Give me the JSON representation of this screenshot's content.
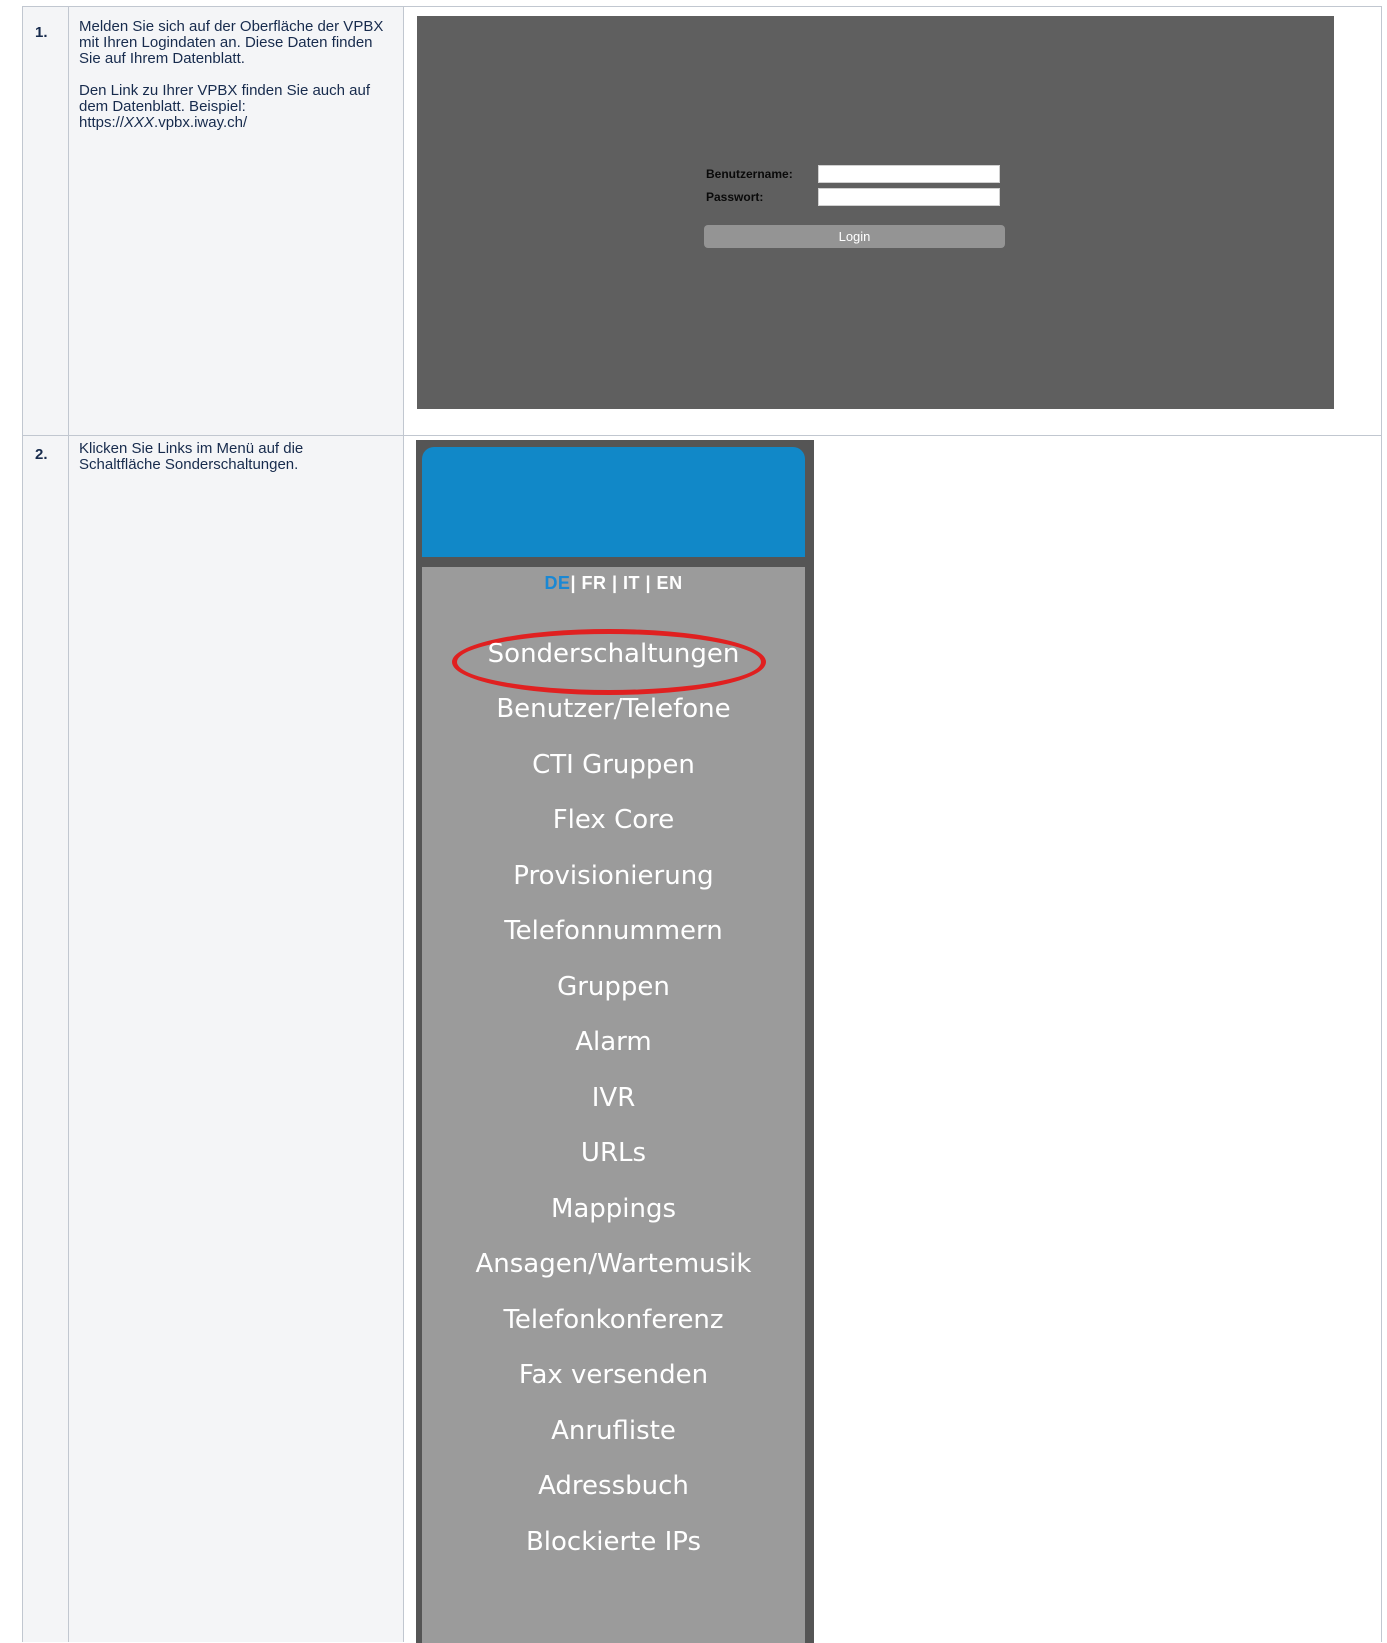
{
  "steps": [
    {
      "number": "1.",
      "paragraph1": "Melden Sie sich auf der Oberfläche der VPBX mit Ihren Logindaten an. Diese Daten finden Sie auf Ihrem Datenblatt.",
      "paragraph2_prefix": "Den Link zu Ihrer VPBX finden Sie auch auf dem Datenblatt. Beispiel: https://",
      "paragraph2_italic": "XXX",
      "paragraph2_suffix": ".vpbx.iway.ch/"
    },
    {
      "number": "2.",
      "paragraph1": "Klicken Sie Links im Menü auf die Schaltfläche Sonderschaltungen."
    }
  ],
  "login_form": {
    "username_label": "Benutzername:",
    "password_label": "Passwort:",
    "login_button": "Login"
  },
  "menu": {
    "languages": {
      "active": "DE",
      "others": "| FR | IT | EN"
    },
    "items": [
      "Sonderschaltungen",
      "Benutzer/Telefone",
      "CTI Gruppen",
      "Flex Core",
      "Provisionierung",
      "Telefonnummern",
      "Gruppen",
      "Alarm",
      "IVR",
      "URLs",
      "Mappings",
      "Ansagen/Wartemusik",
      "Telefonkonferenz",
      "Fax versenden",
      "Anrufliste",
      "Adressbuch",
      "Blockierte IPs"
    ]
  },
  "colors": {
    "menu_header": "#1188c8",
    "menu_panel": "#9b9b9b",
    "login_bg": "#5f5f5f",
    "highlight": "#e02020"
  }
}
